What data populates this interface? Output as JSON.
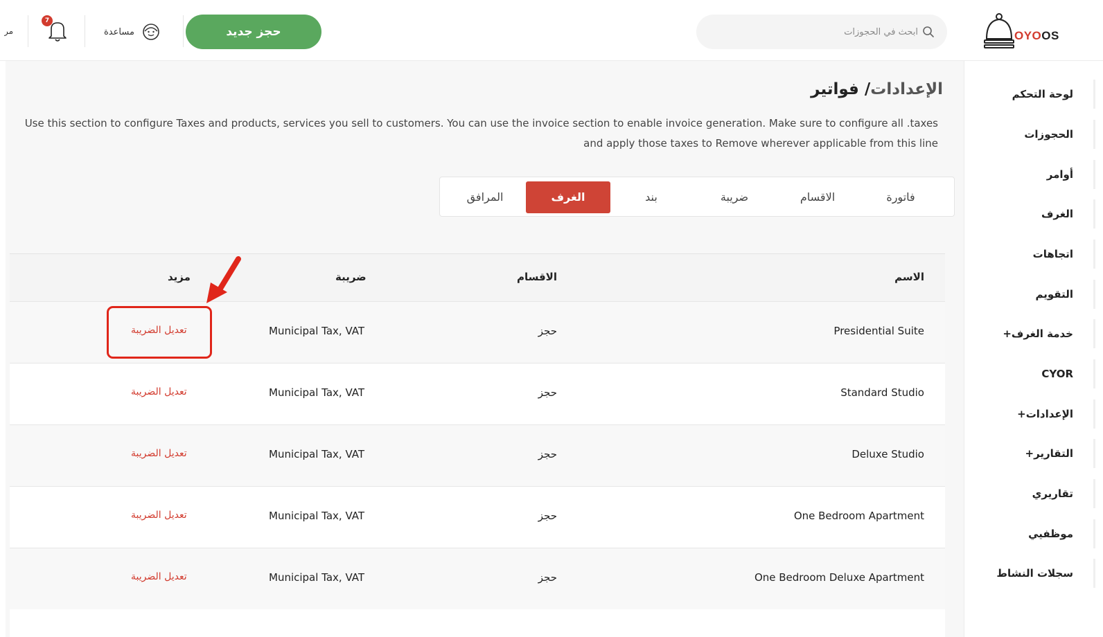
{
  "brand": {
    "logo_oyo": "OYO",
    "logo_os": "OS",
    "accent": "#d23b2e"
  },
  "header": {
    "search_placeholder": "ابحث في الحجوزات",
    "new_booking_label": "حجز جديد",
    "help_label": "مساعدة",
    "notification_count": "7",
    "user_fragment": "مر",
    "new_booking_color": "#5aa85e"
  },
  "sidebar": {
    "items": [
      {
        "label": "لوحة التحكم"
      },
      {
        "label": "الحجوزات"
      },
      {
        "label": "أوامر"
      },
      {
        "label": "الغرف"
      },
      {
        "label": "اتجاهات"
      },
      {
        "label": "التقويم"
      },
      {
        "label": "خدمة الغرف+"
      },
      {
        "label": "CYOR"
      },
      {
        "label": "الإعدادات+"
      },
      {
        "label": "التقارير+"
      },
      {
        "label": "تقاريري"
      },
      {
        "label": "موظفيي"
      },
      {
        "label": "سجلات النشاط"
      }
    ]
  },
  "page": {
    "breadcrumb_parent": "الإعدادات",
    "breadcrumb_separator": "/",
    "breadcrumb_current": "فواتير",
    "description": "Use this section to configure Taxes and products, services you sell to customers. You can use the invoice section to enable invoice generation. Make sure to configure all .taxes and apply those taxes to Remove wherever applicable from this line"
  },
  "tabs": [
    {
      "label": "فاتورة",
      "active": false
    },
    {
      "label": "الاقسام",
      "active": false
    },
    {
      "label": "ضريبة",
      "active": false
    },
    {
      "label": "بند",
      "active": false
    },
    {
      "label": "الغرف",
      "active": true
    },
    {
      "label": "المرافق",
      "active": false
    }
  ],
  "table": {
    "headers": {
      "name": "الاسم",
      "category": "الاقسام",
      "tax": "ضريبة",
      "more": "مزيد"
    },
    "rows": [
      {
        "name": "Presidential Suite",
        "category": "حجز",
        "tax": "Municipal Tax, VAT",
        "action": "تعديل الضريبة"
      },
      {
        "name": "Standard Studio",
        "category": "حجز",
        "tax": "Municipal Tax, VAT",
        "action": "تعديل الضريبة"
      },
      {
        "name": "Deluxe Studio",
        "category": "حجز",
        "tax": "Municipal Tax, VAT",
        "action": "تعديل الضريبة"
      },
      {
        "name": "One Bedroom Apartment",
        "category": "حجز",
        "tax": "Municipal Tax, VAT",
        "action": "تعديل الضريبة"
      },
      {
        "name": "One Bedroom Deluxe Apartment",
        "category": "حجز",
        "tax": "Municipal Tax, VAT",
        "action": "تعديل الضريبة"
      }
    ]
  },
  "annotation": {
    "color": "#e0261a",
    "target": "edit-tax-link-row-1"
  }
}
